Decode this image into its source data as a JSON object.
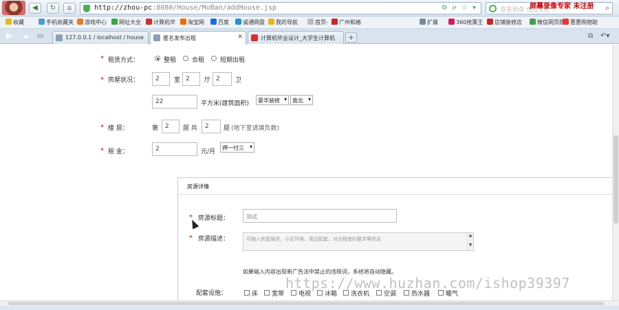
{
  "browser": {
    "url_host": "http://zhou-pc",
    "url_path": ":8080/House/MoBan/addHouse.jsp",
    "search_placeholder": "京东秒杀 低至1元",
    "recorder_label": "屏幕录像专家  未注册"
  },
  "bookmarks": [
    {
      "label": "收藏",
      "color": "#e8b51d"
    },
    {
      "label": "手机收藏夹",
      "color": "#4a9ad8"
    },
    {
      "label": "游戏中心",
      "color": "#e57c1f"
    },
    {
      "label": "网址大全",
      "color": "#3aa64a"
    },
    {
      "label": "计算机毕",
      "color": "#d32f2f"
    },
    {
      "label": "淘宝网",
      "color": "#ef6c00"
    },
    {
      "label": "百度",
      "color": "#1e6fd9"
    },
    {
      "label": "诚通网盘",
      "color": "#2b8fd6"
    },
    {
      "label": "我的导航",
      "color": "#e8b51d"
    },
    {
      "label": "首页-【",
      "color": "#bbbbbb"
    },
    {
      "label": "广州和格",
      "color": "#c62828"
    },
    {
      "label": "扩展",
      "color": "#7a8aa0"
    },
    {
      "label": "360抢票王",
      "color": "#d81b60"
    },
    {
      "label": "店铺装修店",
      "color": "#c62828"
    },
    {
      "label": "微信网页版",
      "color": "#43a047"
    },
    {
      "label": "惠惠购物助",
      "color": "#e53935"
    }
  ],
  "tabs": [
    {
      "label": "127.0.0.1 / localhost / house",
      "active": false,
      "color": "#8aa0b8"
    },
    {
      "label": "匿名发布出租",
      "active": true,
      "color": "#8aa0b8"
    },
    {
      "label": "计算机毕业设计_大学生计算机",
      "active": false,
      "color": "#d32f2f"
    }
  ],
  "form": {
    "rent_type_label": "租赁方式：",
    "rent_options": [
      "整租",
      "合租",
      "短期出租"
    ],
    "rent_selected": 0,
    "house_status_label": "房屋状况：",
    "rooms": "2",
    "room_unit": "室",
    "halls": "2",
    "hall_unit": "厅",
    "baths": "2",
    "bath_unit": "卫",
    "area": "22",
    "area_unit": "平方米(建筑面积)",
    "decoration": "豪华装修",
    "orientation": "南北",
    "floor_label": "楼      层：",
    "floor_prefix": "第",
    "floor": "2",
    "floor_mid": "层 共",
    "total_floors": "2",
    "floor_suffix": "层",
    "floor_hint": "(地下室请填负数)",
    "rent_label": "租      金：",
    "rent": "2",
    "rent_unit": "元/月",
    "payment": "押一付三"
  },
  "details": {
    "panel_title": "房源详情",
    "title_label": "房源标题：",
    "title_value": "测试",
    "desc_label": "房源描述：",
    "desc_placeholder": "可输入房屋描述、小区环境、周边配套、对合租者的要求等信息",
    "ad_warning": "如果输入内容出现新广告法中禁止的违规词，系统将自动隐藏。",
    "facilities_label": "配套设施：",
    "facilities": [
      "床",
      "宽带",
      "电视",
      "冰箱",
      "洗衣机",
      "空调",
      "热水器",
      "暖气"
    ]
  },
  "watermark": "https://www.huzhan.com/ishop39397"
}
